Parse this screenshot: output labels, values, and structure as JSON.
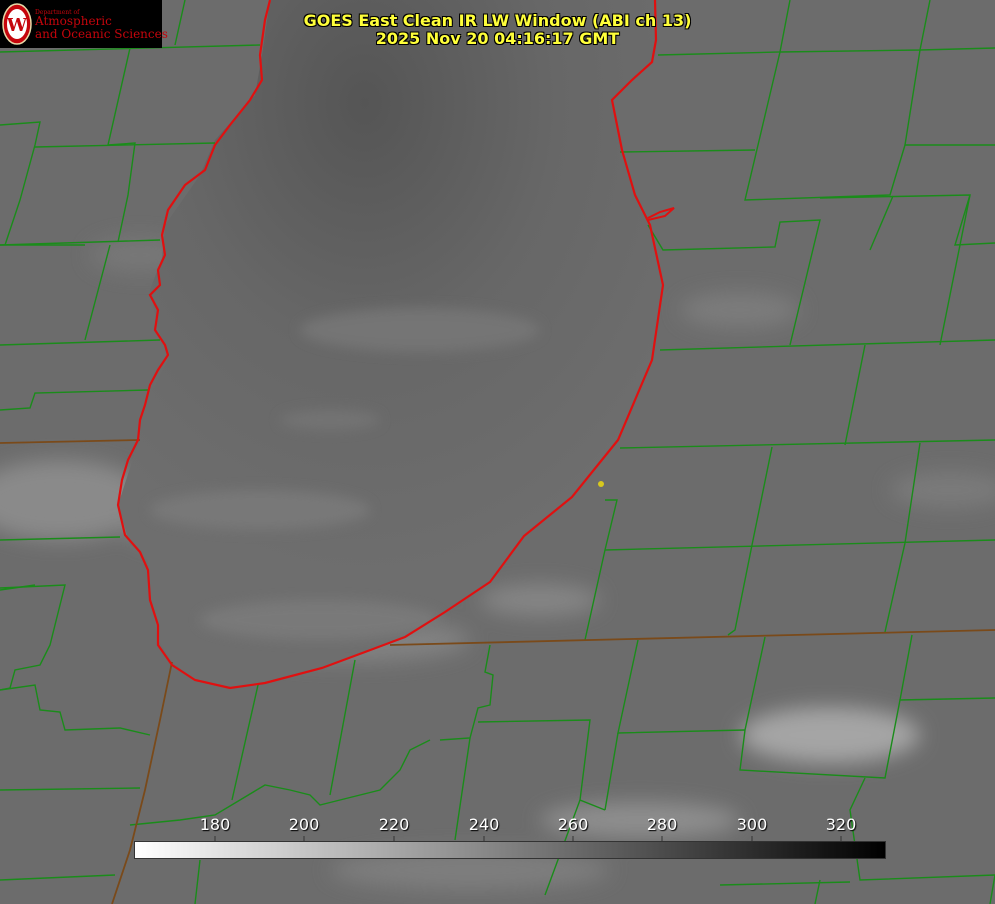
{
  "logo": {
    "department": "Department of",
    "line1": "Atmospheric",
    "line2": "and Oceanic Sciences",
    "seal_icon": "uw-crest-icon",
    "color": "#c5050c"
  },
  "title": {
    "line1": "GOES East Clean IR LW Window (ABI ch 13)",
    "line2": "2025 Nov 20 04:16:17 GMT",
    "color": "#ffff3a"
  },
  "colorbar": {
    "ticks": [
      "180",
      "200",
      "220",
      "240",
      "260",
      "280",
      "300",
      "320"
    ],
    "min": 163,
    "max": 330,
    "colors": {
      "low": "#ffffff",
      "high": "#000000"
    }
  },
  "map": {
    "land_color": "#707070",
    "county_line_color": "#1a8c1a",
    "state_line_color": "#7a4a1a",
    "lake_outline_color": "#e01010",
    "marker_color": "#d7c81e"
  }
}
